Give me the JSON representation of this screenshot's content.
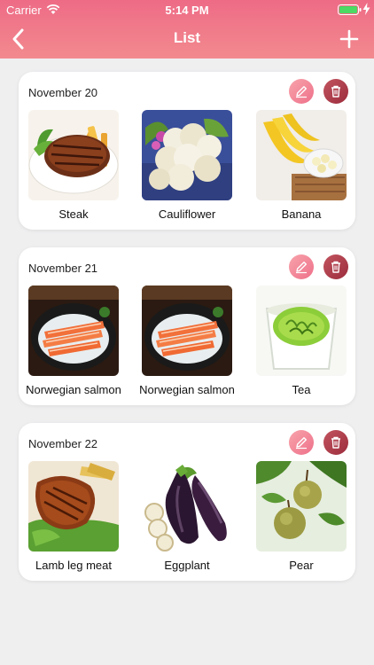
{
  "status_bar": {
    "carrier": "Carrier",
    "time": "5:14 PM"
  },
  "navbar": {
    "title": "List"
  },
  "colors": {
    "header_start": "#ee6b86",
    "header_end": "#f28a8e",
    "edit": "#ee7089",
    "delete": "#9c2c3c"
  },
  "cards": [
    {
      "date": "November 20",
      "items": [
        {
          "name": "Steak"
        },
        {
          "name": "Cauliflower"
        },
        {
          "name": "Banana"
        }
      ]
    },
    {
      "date": "November 21",
      "items": [
        {
          "name": "Norwegian salmon"
        },
        {
          "name": "Norwegian salmon"
        },
        {
          "name": "Tea"
        }
      ]
    },
    {
      "date": "November 22",
      "items": [
        {
          "name": "Lamb leg meat"
        },
        {
          "name": "Eggplant"
        },
        {
          "name": "Pear"
        }
      ]
    }
  ]
}
